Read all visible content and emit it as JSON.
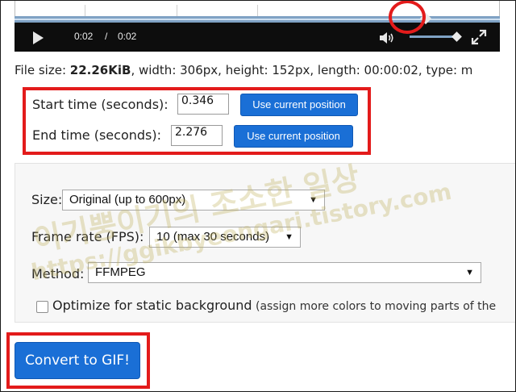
{
  "player": {
    "current_time": "0:02",
    "separator": "/",
    "duration": "0:02",
    "progress_fraction": 1.0,
    "volume_fraction": 0.9
  },
  "file_info": {
    "size_label": "File size: ",
    "size_value": "22.26KiB",
    "rest": ", width: 306px, height: 152px, length: 00:00:02, type: m"
  },
  "trim": {
    "start_label": "Start time (seconds):",
    "start_value": "0.346",
    "end_label": "End time (seconds):",
    "end_value": "2.276",
    "use_position_label": "Use current position"
  },
  "options": {
    "size_label": "Size:",
    "size_value": "Original (up to 600px)",
    "fps_label": "Frame rate (FPS):",
    "fps_value": "10 (max 30 seconds)",
    "method_label": "Method:",
    "method_value": "FFMPEG",
    "optimize_label": "Optimize for static background",
    "optimize_note": " (assign more colors to moving parts of the",
    "optimize_checked": false
  },
  "convert_label": "Convert to GIF!",
  "watermark": {
    "line1": "이기뿡이기의 조소한 일상",
    "line2": "https://ggikbyeongari.tistory.com"
  },
  "colors": {
    "accent_blue": "#1a6fd6",
    "annotation_red": "#e31b1b",
    "player_bg": "#0d0d0d",
    "timeline_blue": "#7fa2c4"
  }
}
